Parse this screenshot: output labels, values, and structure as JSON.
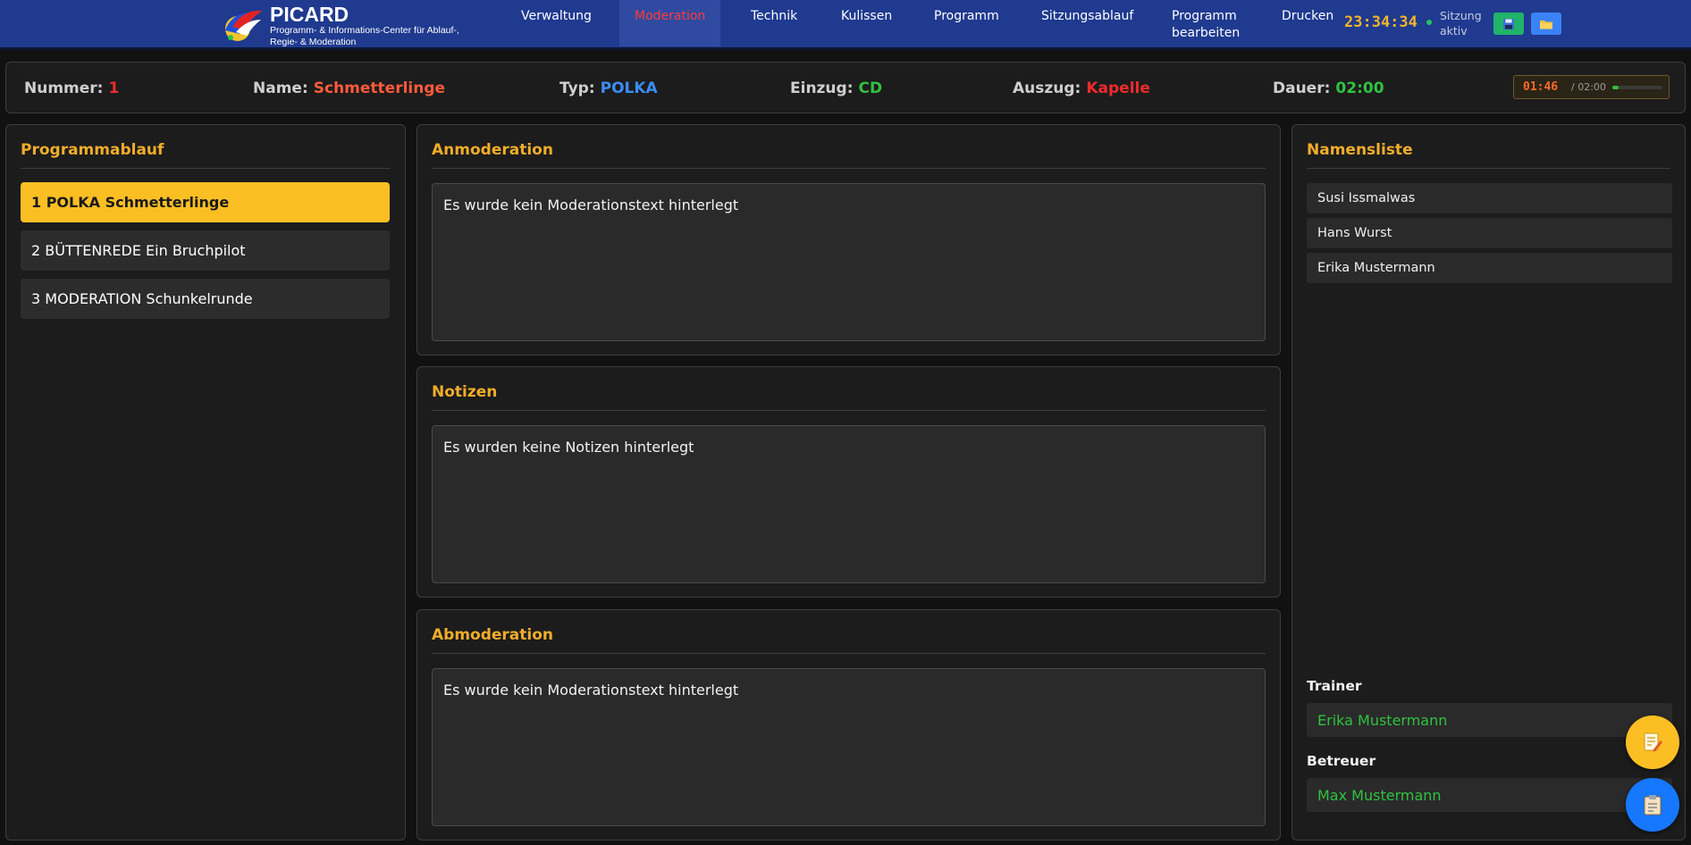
{
  "brand": {
    "title": "PICARD",
    "subtitle": "Programm- & Informations-Center für Ablauf-, Regie- & Moderation"
  },
  "nav": [
    {
      "label": "Verwaltung",
      "active": false
    },
    {
      "label": "Moderation",
      "active": true
    },
    {
      "label": "Technik",
      "active": false
    },
    {
      "label": "Kulissen",
      "active": false
    },
    {
      "label": "Programm",
      "active": false
    },
    {
      "label": "Sitzungsablauf",
      "active": false
    },
    {
      "label": "Programm bearbeiten",
      "active": false
    },
    {
      "label": "Drucken",
      "active": false
    }
  ],
  "clock": "23:34:34",
  "session_status": "Sitzung aktiv",
  "info": {
    "nummer_label": "Nummer:",
    "nummer": "1",
    "name_label": "Name:",
    "name": "Schmetterlinge",
    "typ_label": "Typ:",
    "typ": "POLKA",
    "einzug_label": "Einzug:",
    "einzug": "CD",
    "auszug_label": "Auszug:",
    "auszug": "Kapelle",
    "dauer_label": "Dauer:",
    "dauer": "02:00"
  },
  "timer": {
    "elapsed": "01:46",
    "total": "/ 02:00",
    "progress_fraction": 0.12
  },
  "programmablauf": {
    "title": "Programmablauf",
    "items": [
      {
        "label": "1 POLKA Schmetterlinge",
        "active": true
      },
      {
        "label": "2 BÜTTENREDE Ein Bruchpilot",
        "active": false
      },
      {
        "label": "3 MODERATION Schunkelrunde",
        "active": false
      }
    ]
  },
  "anmoderation": {
    "title": "Anmoderation",
    "text": "Es wurde kein Moderationstext hinterlegt"
  },
  "notizen": {
    "title": "Notizen",
    "text": "Es wurden keine Notizen hinterlegt"
  },
  "abmoderation": {
    "title": "Abmoderation",
    "text": "Es wurde kein Moderationstext hinterlegt"
  },
  "namensliste": {
    "title": "Namensliste",
    "names": [
      "Susi Issmalwas",
      "Hans Wurst",
      "Erika Mustermann"
    ],
    "trainer_label": "Trainer",
    "trainer": "Erika Mustermann",
    "betreuer_label": "Betreuer",
    "betreuer": "Max Mustermann"
  },
  "colors": {
    "accent": "#f0ad2a",
    "nav_bg": "#1f3a8f",
    "active_nav_text": "#ff3b3b",
    "green": "#2fc23f",
    "red": "#ef2b2b",
    "blue": "#3b8cf5"
  },
  "icons": {
    "save": "floppy-disk-icon",
    "open": "folder-icon",
    "edit": "edit-note-icon",
    "list": "clipboard-icon"
  }
}
